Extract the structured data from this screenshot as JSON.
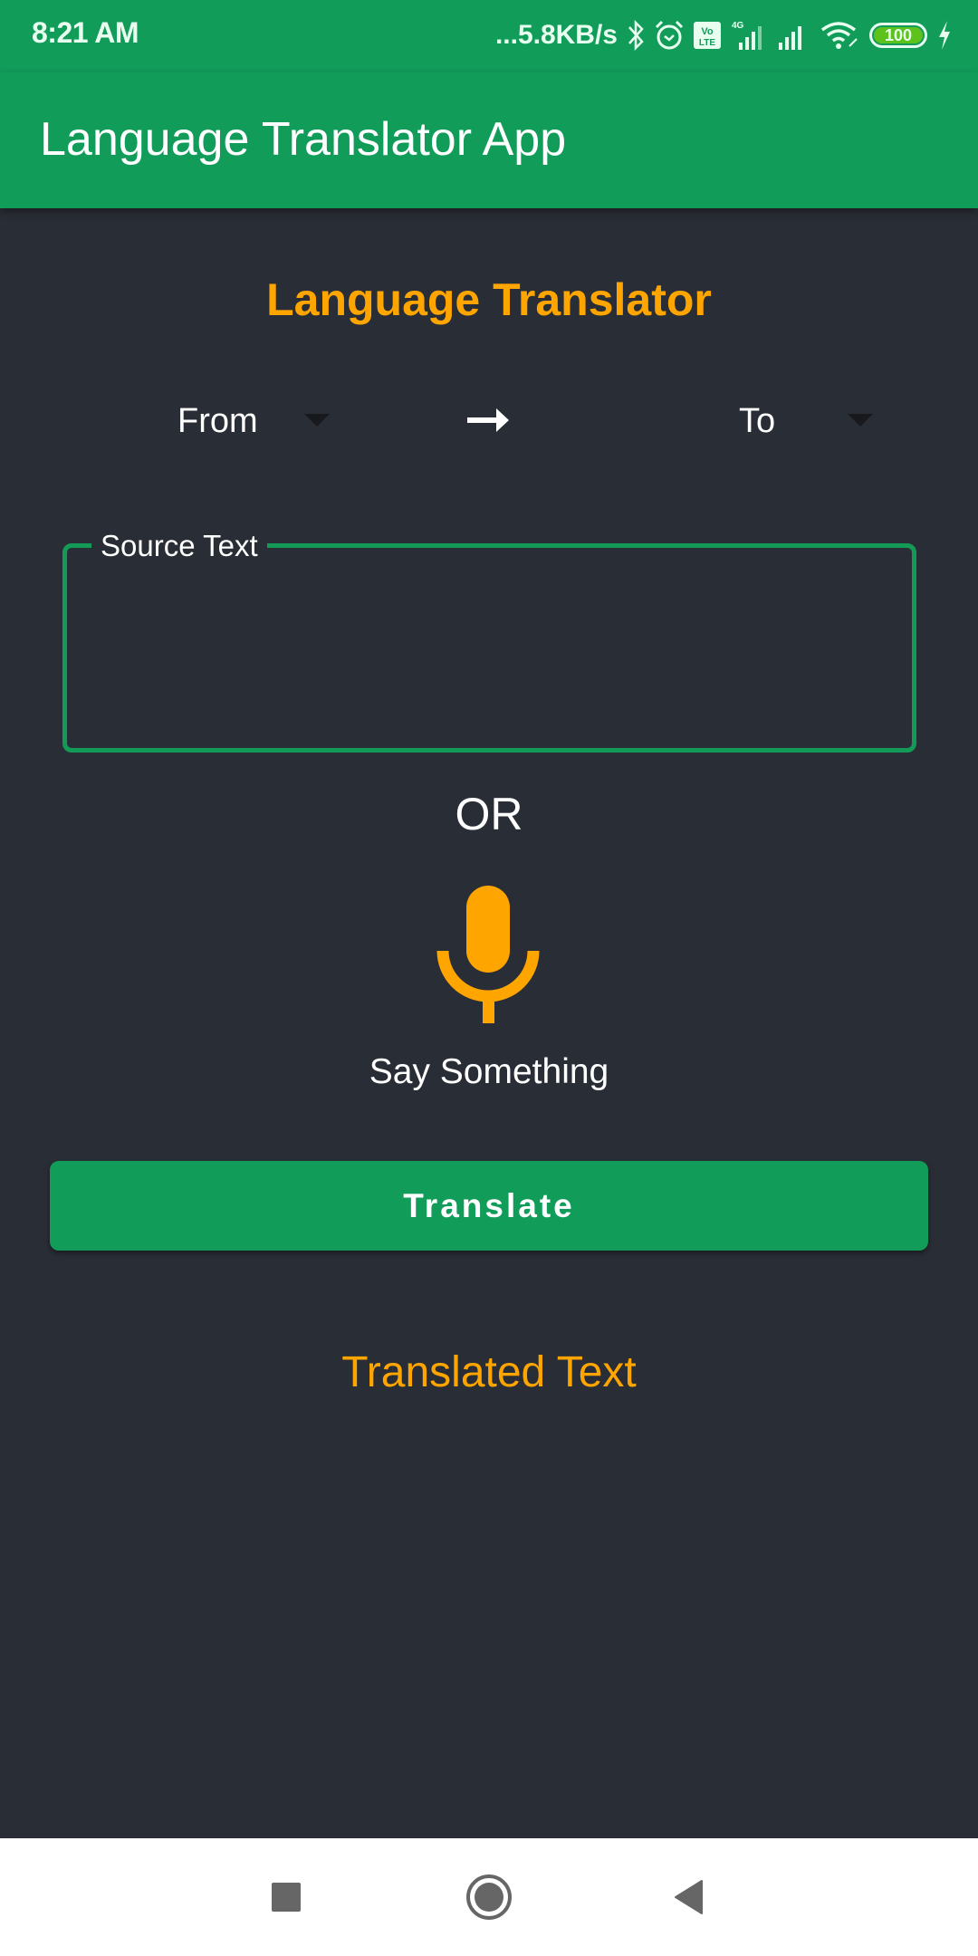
{
  "status_bar": {
    "time": "8:21 AM",
    "network_speed": "...5.8KB/s",
    "battery_level": "100",
    "icons": [
      "bluetooth-icon",
      "alarm-icon",
      "volte-icon",
      "signal-4g-icon",
      "signal-icon",
      "wifi-icon",
      "battery-icon",
      "charging-icon"
    ]
  },
  "app_bar": {
    "title": "Language Translator App",
    "background": "#119c5a"
  },
  "main": {
    "heading": "Language Translator",
    "from_spinner": {
      "selected": "From"
    },
    "to_spinner": {
      "selected": "To"
    },
    "arrow_icon": "right-arrow-icon",
    "source_field": {
      "label": "Source Text",
      "value": "",
      "placeholder": ""
    },
    "or_label": "OR",
    "mic_icon": "microphone-icon",
    "say_label": "Say Something",
    "translate_button": "Translate",
    "translated_text": "Translated Text"
  },
  "colors": {
    "primary": "#119c5a",
    "accent": "#ffa500",
    "background": "#292d35"
  },
  "nav_bar": {
    "buttons": [
      "recents-icon",
      "home-icon",
      "back-icon"
    ]
  }
}
